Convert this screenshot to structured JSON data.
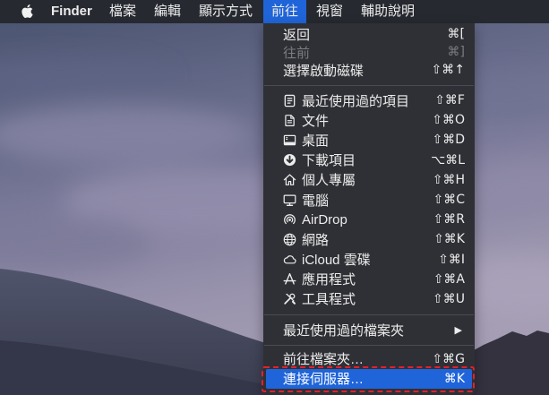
{
  "menubar": {
    "apple_icon": "apple-icon",
    "app_name": "Finder",
    "items": [
      {
        "label": "檔案"
      },
      {
        "label": "編輯"
      },
      {
        "label": "顯示方式"
      },
      {
        "label": "前往",
        "active": true
      },
      {
        "label": "視窗"
      },
      {
        "label": "輔助說明"
      }
    ]
  },
  "go_menu": {
    "sections": [
      {
        "items": [
          {
            "label": "返回",
            "shortcut": "⌘["
          },
          {
            "label": "往前",
            "shortcut": "⌘]",
            "disabled": true
          },
          {
            "label": "選擇啟動磁碟",
            "shortcut": "⇧⌘↑"
          }
        ]
      },
      {
        "items": [
          {
            "label": "最近使用過的項目",
            "shortcut": "⇧⌘F",
            "icon": "recents-icon"
          },
          {
            "label": "文件",
            "shortcut": "⇧⌘O",
            "icon": "documents-icon"
          },
          {
            "label": "桌面",
            "shortcut": "⇧⌘D",
            "icon": "desktop-icon"
          },
          {
            "label": "下載項目",
            "shortcut": "⌥⌘L",
            "icon": "downloads-icon"
          },
          {
            "label": "個人專屬",
            "shortcut": "⇧⌘H",
            "icon": "home-icon"
          },
          {
            "label": "電腦",
            "shortcut": "⇧⌘C",
            "icon": "computer-icon"
          },
          {
            "label": "AirDrop",
            "shortcut": "⇧⌘R",
            "icon": "airdrop-icon"
          },
          {
            "label": "網路",
            "shortcut": "⇧⌘K",
            "icon": "network-icon"
          },
          {
            "label": "iCloud 雲碟",
            "shortcut": "⇧⌘I",
            "icon": "icloud-icon"
          },
          {
            "label": "應用程式",
            "shortcut": "⇧⌘A",
            "icon": "applications-icon"
          },
          {
            "label": "工具程式",
            "shortcut": "⇧⌘U",
            "icon": "utilities-icon"
          }
        ]
      },
      {
        "items": [
          {
            "label": "最近使用過的檔案夾",
            "submenu_arrow": "▶"
          }
        ]
      },
      {
        "items": [
          {
            "label": "前往檔案夾…",
            "shortcut": "⇧⌘G"
          },
          {
            "label": "連接伺服器…",
            "shortcut": "⌘K",
            "highlighted": true
          }
        ]
      }
    ]
  },
  "colors": {
    "menubar_background": "#262930",
    "menu_background": "#2f3035",
    "selection_blue": "#1f64d9",
    "text": "#ececec",
    "disabled_text": "#7b7b80",
    "separator": "#4b4c51",
    "annotation_red": "#e3212b"
  }
}
